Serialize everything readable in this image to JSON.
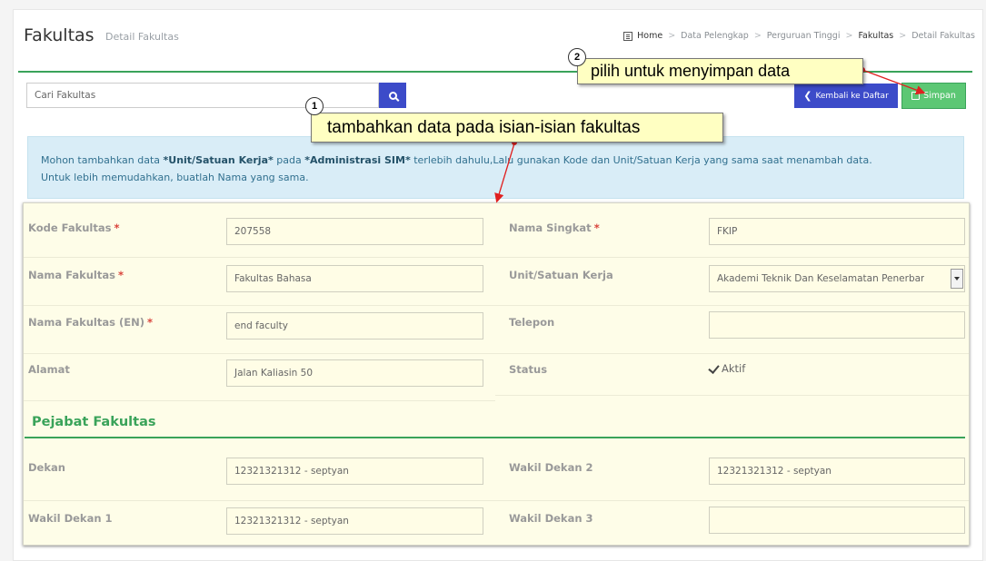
{
  "header": {
    "title": "Fakultas",
    "subtitle": "Detail Fakultas"
  },
  "breadcrumb": {
    "icon": "dashboard-icon",
    "items": [
      "Home",
      "Data Pelengkap",
      "Perguruan Tinggi",
      "Fakultas",
      "Detail Fakultas"
    ]
  },
  "toolbar": {
    "search_placeholder": "Cari Fakultas",
    "back_label": "Kembali ke Daftar",
    "save_label": "Simpan"
  },
  "alert": {
    "p1": "Mohon tambahkan data ",
    "b1": "*Unit/Satuan Kerja*",
    "p2": " pada ",
    "b2": "*Administrasi SIM*",
    "p3": " terlebih dahulu,Lalu gunakan Kode dan Unit/Satuan Kerja yang sama saat menambah data.",
    "line2": "Untuk lebih memudahkan, buatlah Nama yang sama."
  },
  "form": {
    "kode_fakultas": {
      "label": "Kode Fakultas",
      "required": "*",
      "value": "207558"
    },
    "nama_singkat": {
      "label": "Nama Singkat",
      "required": "*",
      "value": "FKIP"
    },
    "nama_fakultas": {
      "label": "Nama Fakultas",
      "required": "*",
      "value": "Fakultas Bahasa"
    },
    "unit_kerja": {
      "label": "Unit/Satuan Kerja",
      "value": "Akademi Teknik Dan Keselamatan Penerbar"
    },
    "nama_fakultas_en": {
      "label": "Nama Fakultas (EN)",
      "required": "*",
      "value": "end faculty"
    },
    "telepon": {
      "label": "Telepon",
      "value": ""
    },
    "alamat": {
      "label": "Alamat",
      "value": "Jalan Kaliasin 50"
    },
    "status": {
      "label": "Status",
      "checkbox_label": "Aktif",
      "checked": true
    }
  },
  "pejabat": {
    "title": "Pejabat Fakultas",
    "dekan": {
      "label": "Dekan",
      "value": "12321321312 - septyan"
    },
    "wakil_dekan_2": {
      "label": "Wakil Dekan 2",
      "value": "12321321312 - septyan"
    },
    "wakil_dekan_1": {
      "label": "Wakil Dekan 1",
      "value": "12321321312 - septyan"
    },
    "wakil_dekan_3": {
      "label": "Wakil Dekan 3",
      "value": ""
    }
  },
  "annotations": [
    {
      "number": "1",
      "text": "tambahkan data pada isian-isian fakultas"
    },
    {
      "number": "2",
      "text": "pilih untuk menyimpan data"
    }
  ],
  "colors": {
    "accent_green": "#3aa35a",
    "button_blue": "#3c4bc9",
    "save_green": "#5cc774",
    "required_red": "#d9433b",
    "callout_yellow": "#ffffc2",
    "arrow_red": "#e02020"
  }
}
